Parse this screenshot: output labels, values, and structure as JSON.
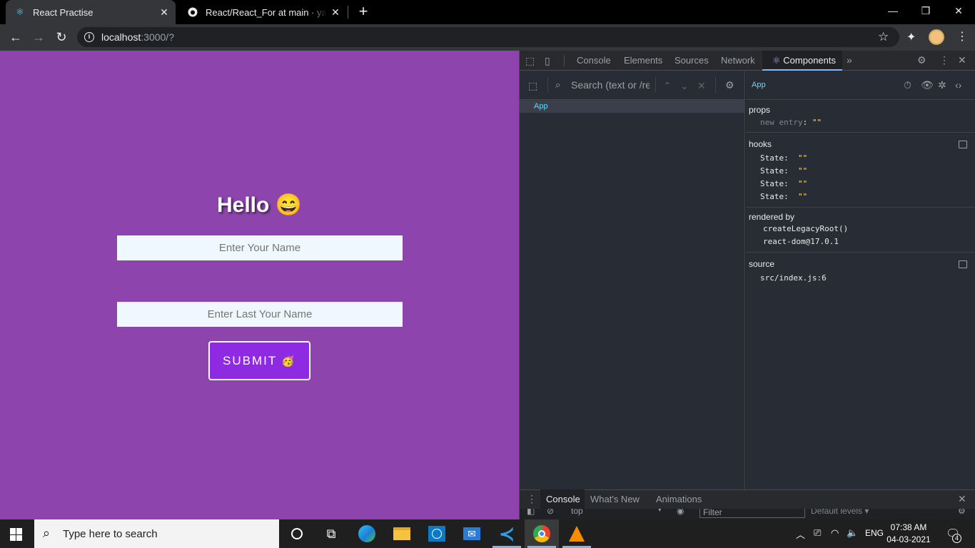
{
  "browser": {
    "tabs": [
      {
        "title": "React Practise",
        "icon": "react-icon",
        "active": true
      },
      {
        "title": "React/React_For at main · yadavs",
        "icon": "github-icon",
        "active": false
      }
    ],
    "url_host": "localhost",
    "url_rest": ":3000/?"
  },
  "app": {
    "heading": "Hello",
    "heading_emoji": "😄",
    "first_name_placeholder": "Enter Your Name",
    "last_name_placeholder": "Enter Last Your Name",
    "submit_label": "SUBMIT",
    "submit_emoji": "🥳"
  },
  "devtools": {
    "tabs": [
      "Console",
      "Elements",
      "Sources",
      "Network",
      "Components"
    ],
    "active_tab": "Components",
    "search_placeholder": "Search (text or /regex/)",
    "tree": [
      "App"
    ],
    "selected": "App",
    "props": {
      "title": "props",
      "entry_key": "new entry",
      "entry_value": "\"\""
    },
    "hooks": {
      "title": "hooks",
      "items": [
        {
          "key": "State:",
          "value": "\"\""
        },
        {
          "key": "State:",
          "value": "\"\""
        },
        {
          "key": "State:",
          "value": "\"\""
        },
        {
          "key": "State:",
          "value": "\"\""
        }
      ]
    },
    "rendered_by": {
      "title": "rendered by",
      "items": [
        "createLegacyRoot()",
        "react-dom@17.0.1"
      ]
    },
    "source": {
      "title": "source",
      "value": "src/index.js:6"
    },
    "drawer": {
      "tabs": [
        "Console",
        "What's New",
        "Animations"
      ],
      "context": "top",
      "filter_placeholder": "Filter",
      "levels": "Default levels ▾"
    }
  },
  "taskbar": {
    "search_placeholder": "Type here to search",
    "language": "ENG",
    "time": "07:38 AM",
    "date": "04-03-2021",
    "notification_count": "4"
  }
}
